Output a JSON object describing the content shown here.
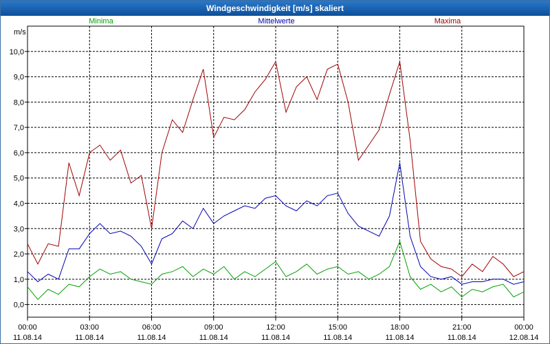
{
  "window": {
    "title": "Windgeschwindigkeit [m/s] skaliert"
  },
  "chart_data": {
    "type": "line",
    "title": "Windgeschwindigkeit [m/s] skaliert",
    "ylabel": "m/s",
    "xlabel": "",
    "ylim": [
      -0.5,
      11.0
    ],
    "xlim": [
      0,
      24
    ],
    "grid": true,
    "legend_placement": "top",
    "y_ticks": [
      "0,0",
      "1,0",
      "2,0",
      "3,0",
      "4,0",
      "5,0",
      "6,0",
      "7,0",
      "8,0",
      "9,0",
      "10,0"
    ],
    "y_tick_values": [
      0,
      1,
      2,
      3,
      4,
      5,
      6,
      7,
      8,
      9,
      10
    ],
    "x_ticks": [
      {
        "hour": 0,
        "time": "00:00",
        "date": "11.08.14"
      },
      {
        "hour": 3,
        "time": "03:00",
        "date": "11.08.14"
      },
      {
        "hour": 6,
        "time": "06:00",
        "date": "11.08.14"
      },
      {
        "hour": 9,
        "time": "09:00",
        "date": "11.08.14"
      },
      {
        "hour": 12,
        "time": "12:00",
        "date": "11.08.14"
      },
      {
        "hour": 15,
        "time": "15:00",
        "date": "11.08.14"
      },
      {
        "hour": 18,
        "time": "18:00",
        "date": "11.08.14"
      },
      {
        "hour": 21,
        "time": "21:00",
        "date": "11.08.14"
      },
      {
        "hour": 24,
        "time": "00:00",
        "date": "12.08.14"
      }
    ],
    "series": [
      {
        "name": "Minima",
        "color": "#00a000",
        "x": [
          0,
          0.5,
          1,
          1.5,
          2,
          2.5,
          3,
          3.5,
          4,
          4.5,
          5,
          5.5,
          6,
          6.5,
          7,
          7.5,
          8,
          8.5,
          9,
          9.5,
          10,
          10.5,
          11,
          11.5,
          12,
          12.5,
          13,
          13.5,
          14,
          14.5,
          15,
          15.5,
          16,
          16.5,
          17,
          17.5,
          18,
          18.5,
          19,
          19.5,
          20,
          20.5,
          21,
          21.5,
          22,
          22.5,
          23,
          23.5,
          24
        ],
        "values": [
          0.7,
          0.2,
          0.6,
          0.4,
          0.8,
          0.7,
          1.1,
          1.4,
          1.2,
          1.3,
          1.0,
          0.9,
          0.8,
          1.2,
          1.3,
          1.5,
          1.1,
          1.4,
          1.2,
          1.5,
          1.0,
          1.3,
          1.1,
          1.4,
          1.7,
          1.1,
          1.3,
          1.6,
          1.2,
          1.4,
          1.5,
          1.2,
          1.3,
          1.0,
          1.2,
          1.5,
          2.5,
          1.1,
          0.6,
          0.8,
          0.5,
          0.7,
          0.3,
          0.6,
          0.5,
          0.7,
          0.8,
          0.3,
          0.5
        ]
      },
      {
        "name": "Mittelwerte",
        "color": "#0000b0",
        "x": [
          0,
          0.5,
          1,
          1.5,
          2,
          2.5,
          3,
          3.5,
          4,
          4.5,
          5,
          5.5,
          6,
          6.5,
          7,
          7.5,
          8,
          8.5,
          9,
          9.5,
          10,
          10.5,
          11,
          11.5,
          12,
          12.5,
          13,
          13.5,
          14,
          14.5,
          15,
          15.5,
          16,
          16.5,
          17,
          17.5,
          18,
          18.5,
          19,
          19.5,
          20,
          20.5,
          21,
          21.5,
          22,
          22.5,
          23,
          23.5,
          24
        ],
        "values": [
          1.3,
          0.9,
          1.2,
          1.0,
          2.2,
          2.2,
          2.8,
          3.2,
          2.8,
          2.9,
          2.7,
          2.3,
          1.6,
          2.6,
          2.8,
          3.3,
          3.0,
          3.8,
          3.2,
          3.5,
          3.7,
          3.9,
          3.8,
          4.2,
          4.3,
          3.9,
          3.7,
          4.1,
          3.9,
          4.3,
          4.4,
          3.6,
          3.1,
          2.9,
          2.7,
          3.5,
          5.6,
          2.7,
          1.5,
          1.1,
          1.0,
          1.1,
          0.8,
          0.9,
          0.9,
          1.0,
          1.0,
          0.8,
          0.9
        ]
      },
      {
        "name": "Maxima",
        "color": "#a00000",
        "x": [
          0,
          0.5,
          1,
          1.5,
          2,
          2.5,
          3,
          3.5,
          4,
          4.5,
          5,
          5.5,
          6,
          6.5,
          7,
          7.5,
          8,
          8.5,
          9,
          9.5,
          10,
          10.5,
          11,
          11.5,
          12,
          12.5,
          13,
          13.5,
          14,
          14.5,
          15,
          15.5,
          16,
          16.5,
          17,
          17.5,
          18,
          18.5,
          19,
          19.5,
          20,
          20.5,
          21,
          21.5,
          22,
          22.5,
          23,
          23.5,
          24
        ],
        "values": [
          2.4,
          1.6,
          2.4,
          2.3,
          5.6,
          4.3,
          6.0,
          6.3,
          5.7,
          6.1,
          4.8,
          5.1,
          3.0,
          6.0,
          7.3,
          6.8,
          8.1,
          9.3,
          6.6,
          7.4,
          7.3,
          7.7,
          8.4,
          8.9,
          9.6,
          7.6,
          8.6,
          9.0,
          8.1,
          9.3,
          9.5,
          8.0,
          5.7,
          6.3,
          6.9,
          8.3,
          9.6,
          6.5,
          2.5,
          1.8,
          1.5,
          1.4,
          1.1,
          1.6,
          1.3,
          1.9,
          1.6,
          1.1,
          1.3
        ]
      }
    ]
  }
}
